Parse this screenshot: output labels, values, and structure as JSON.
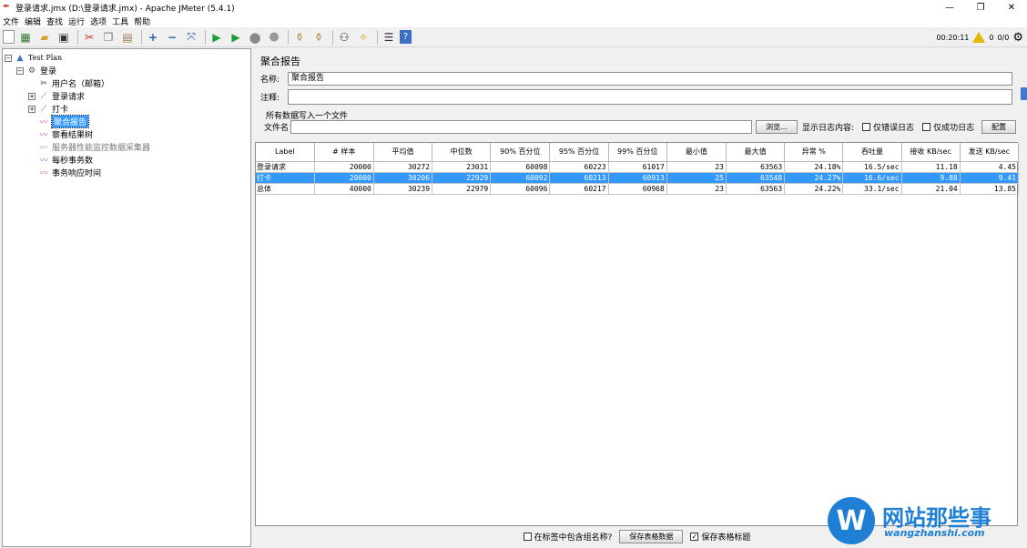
{
  "window": {
    "title": "登录请求.jmx (D:\\登录请求.jmx) - Apache JMeter (5.4.1)",
    "minimize": "—",
    "restore": "❐",
    "close": "✕"
  },
  "menu": [
    "文件",
    "编辑",
    "查找",
    "运行",
    "选项",
    "工具",
    "帮助"
  ],
  "status": {
    "elapsed": "00:20:11",
    "warnings": "0",
    "threads": "0/0"
  },
  "tree": {
    "test_plan": "Test Plan",
    "thread_group": "登录",
    "nodes": [
      "用户名（邮箱）",
      "登录请求",
      "打卡",
      "聚合报告",
      "察看结果树",
      "服务器性能监控数据采集器",
      "每秒事务数",
      "事务响应时间"
    ]
  },
  "report": {
    "title": "聚合报告",
    "name_label": "名称:",
    "name_value": "聚合报告",
    "comment_label": "注释:",
    "comment_value": "",
    "write_all_label": "所有数据写入一个文件",
    "filename_label": "文件名",
    "filename_value": "",
    "browse_button": "浏览...",
    "log_label": "显示日志内容:",
    "errors_only": "仅错误日志",
    "success_only": "仅成功日志",
    "configure_button": "配置",
    "columns": [
      "Label",
      "# 样本",
      "平均值",
      "中位数",
      "90% 百分位",
      "95% 百分位",
      "99% 百分位",
      "最小值",
      "最大值",
      "异常 %",
      "吞吐量",
      "接收 KB/sec",
      "发送 KB/sec"
    ],
    "rows": [
      [
        "登录请求",
        "20000",
        "30272",
        "23031",
        "60098",
        "60223",
        "61017",
        "23",
        "63563",
        "24.18%",
        "16.5/sec",
        "11.18",
        "4.45"
      ],
      [
        "打卡",
        "20000",
        "30206",
        "22929",
        "60092",
        "60213",
        "60913",
        "25",
        "63548",
        "24.27%",
        "16.6/sec",
        "9.88",
        "9.41"
      ],
      [
        "总体",
        "40000",
        "30239",
        "22979",
        "60096",
        "60217",
        "60968",
        "23",
        "63563",
        "24.22%",
        "33.1/sec",
        "21.04",
        "13.85"
      ]
    ],
    "include_group_name": "在标签中包含组名称?",
    "save_table_button": "保存表格数据",
    "save_header": "保存表格标题"
  },
  "watermark": {
    "logo": "W",
    "text": "网站那些事",
    "url": "wangzhanshi.com"
  }
}
